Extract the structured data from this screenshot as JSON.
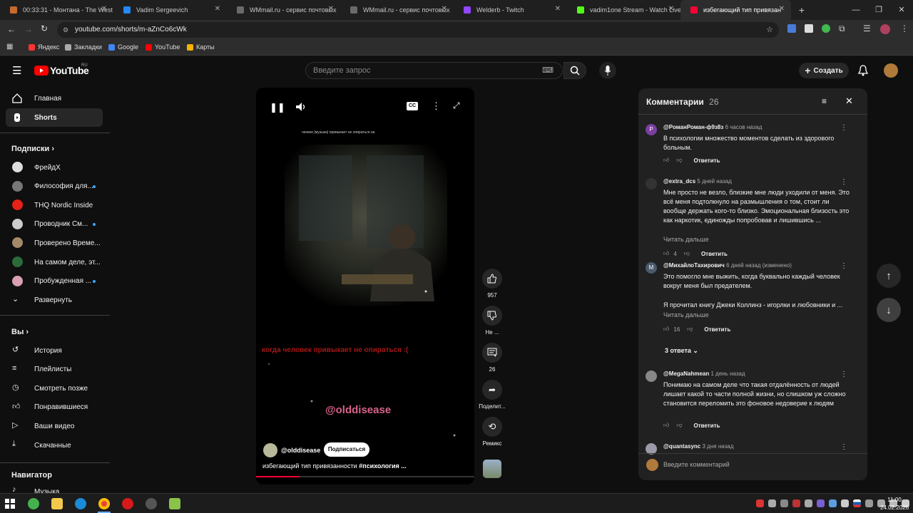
{
  "browser": {
    "tabs": [
      {
        "title": "00:33:31 - Монтана - The West",
        "color": "#c76a2e"
      },
      {
        "title": "Vadim Sergeevich",
        "color": "#2787f5"
      },
      {
        "title": "WMmail.ru - сервис почтовых",
        "color": "#6a6a6a"
      },
      {
        "title": "WMmail.ru - сервис почтовых",
        "color": "#6a6a6a"
      },
      {
        "title": "Welderb - Twitch",
        "color": "#9146ff"
      },
      {
        "title": "vadim1one Stream - Watch Live",
        "color": "#53fc18"
      },
      {
        "title": "избегающий тип привязан",
        "color": "#ff0033"
      }
    ],
    "new_tab": "+",
    "url": "youtube.com/shorts/m-aZnCo6cWk",
    "bookmarks": [
      {
        "label": "Яндекс",
        "color": "#ff3333"
      },
      {
        "label": "Закладки",
        "color": "#aaaaaa"
      },
      {
        "label": "Google",
        "color": "#4285f4"
      },
      {
        "label": "YouTube",
        "color": "#ff0000"
      },
      {
        "label": "Карты",
        "color": "#f4b400"
      }
    ]
  },
  "header": {
    "logo": "YouTube",
    "region": "RU",
    "search_placeholder": "Введите запрос",
    "create_label": "Создать"
  },
  "sidebar": {
    "home": "Главная",
    "shorts": "Shorts",
    "subscriptions_title": "Подписки",
    "subscriptions": [
      {
        "label": "ФрейдХ",
        "color": "#dddddd",
        "dot": false
      },
      {
        "label": "Философия для...",
        "color": "#777777",
        "dot": true
      },
      {
        "label": "THQ Nordic Inside",
        "color": "#e62117",
        "dot": false
      },
      {
        "label": "Проводник См...",
        "color": "#cccccc",
        "dot": true
      },
      {
        "label": "Проверено Време...",
        "color": "#a58a6a",
        "dot": false
      },
      {
        "label": "На самом деле, эт...",
        "color": "#2b6b3a",
        "dot": false
      },
      {
        "label": "Пробужденная ...",
        "color": "#d8a0b0",
        "dot": true
      }
    ],
    "expand": "Развернуть",
    "you_title": "Вы",
    "you_items": [
      "История",
      "Плейлисты",
      "Смотреть позже",
      "Понравившиеся",
      "Ваши видео",
      "Скачанные"
    ],
    "navigator_title": "Навигатор",
    "navigator_items": [
      "Музыка"
    ]
  },
  "video": {
    "caption_top": "чеовек (музыка) привыкает не опираться на",
    "overlay_red": "когда человек привыкает не опираться :(",
    "watermark": "@olddisease",
    "channel": "@olddisease",
    "subscribe": "Подписаться",
    "title_plain": "избегающий тип привязанности ",
    "title_tag": "#психология ...",
    "progress": 0.2
  },
  "actions": {
    "likes": "957",
    "dislike": "Не ...",
    "comments": "26",
    "share": "Поделит...",
    "remix": "Ремикс"
  },
  "comments_panel": {
    "title": "Комментарии",
    "count": "26",
    "input_placeholder": "Введите комментарий",
    "items": [
      {
        "author": "@РоманРоман-ф9з8з",
        "time": "6 часов назад",
        "text": "В психологии множество моментов сделать из здорового больным.",
        "more": "",
        "likes": "",
        "reply": "Ответить",
        "avatar_letter": "Р",
        "avatar_color": "#7b3fa0"
      },
      {
        "author": "@extra_dcs",
        "time": "5 дней назад",
        "text": "Мне просто не везло, близкие мне люди уходили от меня. Это всё меня подтолкнуло на размышления о том, стоит ли вообще держать кого-то близко. Эмоциональная близость это как наркотик, единожды попробовав и лишившись ...",
        "more": "Читать дальше",
        "likes": "4",
        "reply": "Ответить",
        "avatar_letter": "",
        "avatar_color": "#333333"
      },
      {
        "author": "@МихайлоТахирович",
        "time": "6 дней назад (изменено)",
        "text": "Это помогло мне выжить, когда буквально каждый человек вокруг меня был предателем.",
        "text2": "Я прочитал книгу Джеки Коллинз - игорлки и любовники и ...",
        "more": "Читать дальше",
        "likes": "16",
        "reply": "Ответить",
        "replies": "3 ответа",
        "avatar_letter": "М",
        "avatar_color": "#4a5a6a"
      },
      {
        "author": "@MegaNahmean",
        "time": "1 день назад",
        "text": "Понимаю на самом деле что такая отдалённость от людей лишает какой то части полной жизни, но слишком уж сложно становится переломить это фоновое недоверие к людям",
        "more": "",
        "likes": "",
        "reply": "Ответить",
        "avatar_letter": "",
        "avatar_color": "#888888"
      },
      {
        "author": "@quantasync",
        "time": "3 дня назад",
        "text": "",
        "more": "",
        "likes": "",
        "reply": "",
        "avatar_letter": "",
        "avatar_color": "#9a9aa8"
      }
    ]
  },
  "taskbar": {
    "time": "11:00",
    "date": "24.02.2026"
  }
}
